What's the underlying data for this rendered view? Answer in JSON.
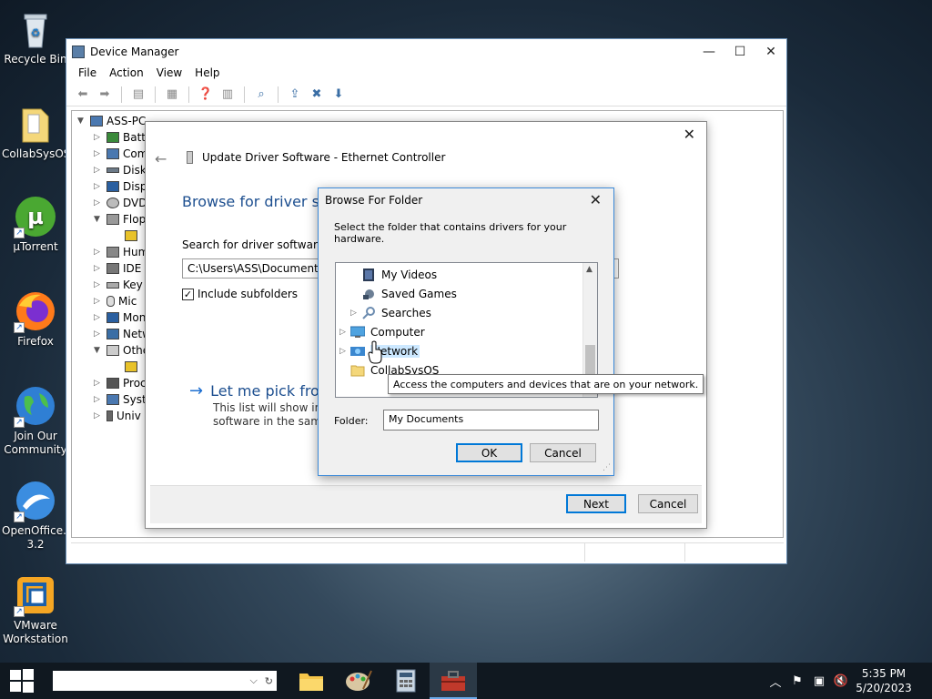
{
  "desktop": {
    "icons": [
      {
        "label": "Recycle Bin"
      },
      {
        "label": "CollabSysOS"
      },
      {
        "label": "µTorrent"
      },
      {
        "label": "Firefox"
      },
      {
        "label": "Join Our Community"
      },
      {
        "label": "OpenOffice... 3.2"
      },
      {
        "label": "VMware Workstation"
      }
    ]
  },
  "device_manager": {
    "title": "Device Manager",
    "menu": [
      "File",
      "Action",
      "View",
      "Help"
    ],
    "tree": {
      "root": "ASS-PC",
      "items": [
        "Batt",
        "Com",
        "Disk",
        "Disp",
        "DVD",
        "Flop",
        "",
        "Hum",
        "IDE",
        "Key",
        "Mic",
        "Mon",
        "Netw",
        "Othe",
        "",
        "Proc",
        "Syst",
        "Univ"
      ]
    }
  },
  "update_driver": {
    "header": "Update Driver Software - Ethernet Controller",
    "heading": "Browse for driver soft",
    "search_label": "Search for driver software in",
    "path": "C:\\Users\\ASS\\Documents",
    "include_subfolders": "Include subfolders",
    "pick_link": "Let me pick from",
    "pick_desc_1": "This list will show insta",
    "pick_desc_2": "software in the same c",
    "next": "Next",
    "cancel": "Cancel"
  },
  "browse_folder": {
    "title": "Browse For Folder",
    "instruction": "Select the folder that contains drivers for your hardware.",
    "tree": [
      {
        "label": "My Videos"
      },
      {
        "label": "Saved Games"
      },
      {
        "label": "Searches"
      },
      {
        "label": "Computer"
      },
      {
        "label": "Network"
      },
      {
        "label": "CollabSysOS"
      }
    ],
    "tooltip": "Access the computers and devices that are on your network.",
    "folder_label": "Folder:",
    "folder_value": "My Documents",
    "ok": "OK",
    "cancel": "Cancel"
  },
  "taskbar": {
    "time": "5:35 PM",
    "date": "5/20/2023"
  }
}
